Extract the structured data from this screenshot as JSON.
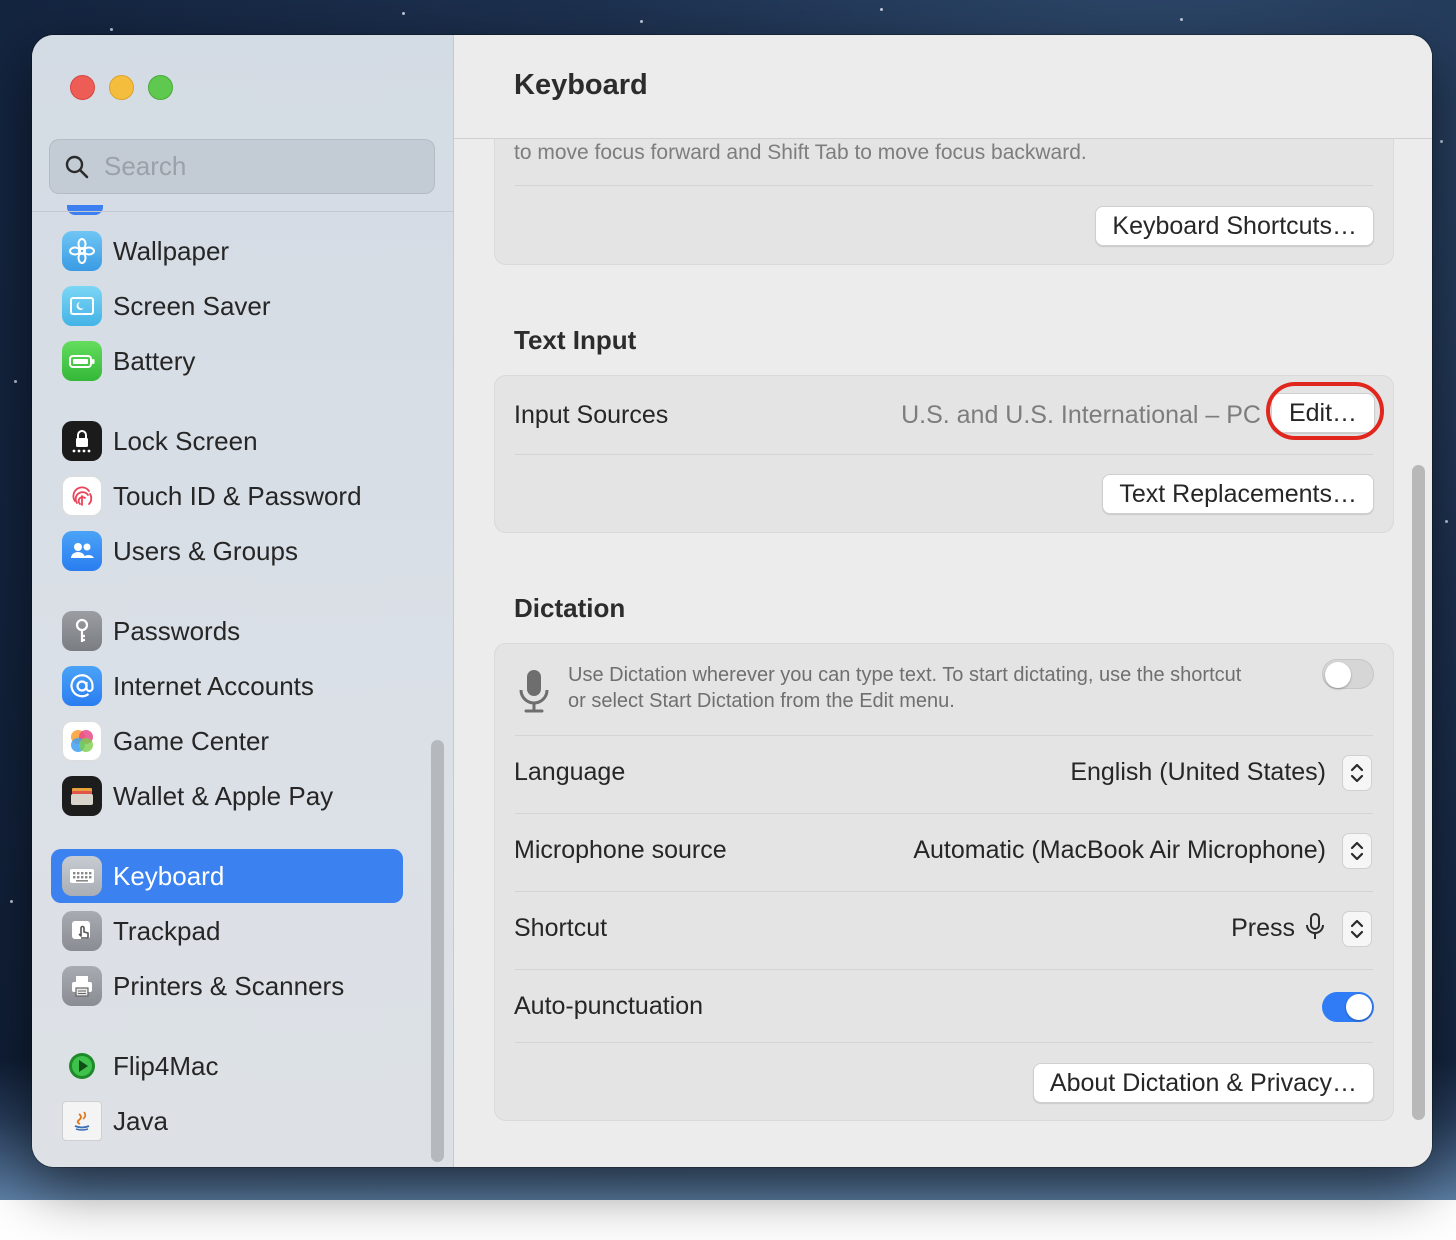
{
  "window": {
    "title": "Keyboard"
  },
  "search": {
    "placeholder": "Search"
  },
  "sidebar": {
    "items": [
      {
        "label": "Wallpaper",
        "icon": "wallpaper-icon"
      },
      {
        "label": "Screen Saver",
        "icon": "screen-saver-icon"
      },
      {
        "label": "Battery",
        "icon": "battery-icon"
      },
      {
        "label": "Lock Screen",
        "icon": "lock-icon"
      },
      {
        "label": "Touch ID & Password",
        "icon": "fingerprint-icon"
      },
      {
        "label": "Users & Groups",
        "icon": "users-icon"
      },
      {
        "label": "Passwords",
        "icon": "key-icon"
      },
      {
        "label": "Internet Accounts",
        "icon": "at-sign-icon"
      },
      {
        "label": "Game Center",
        "icon": "game-center-icon"
      },
      {
        "label": "Wallet & Apple Pay",
        "icon": "wallet-icon"
      },
      {
        "label": "Keyboard",
        "icon": "keyboard-icon",
        "selected": true
      },
      {
        "label": "Trackpad",
        "icon": "trackpad-icon"
      },
      {
        "label": "Printers & Scanners",
        "icon": "printer-icon"
      },
      {
        "label": "Flip4Mac",
        "icon": "flip4mac-icon"
      },
      {
        "label": "Java",
        "icon": "java-icon"
      }
    ]
  },
  "keyboard_nav": {
    "description_tail": "to move focus forward and Shift Tab to move focus backward.",
    "shortcuts_button": "Keyboard Shortcuts…"
  },
  "text_input": {
    "heading": "Text Input",
    "input_sources_label": "Input Sources",
    "input_sources_value": "U.S. and U.S. International – PC",
    "edit_button": "Edit…",
    "replacements_button": "Text Replacements…"
  },
  "dictation": {
    "heading": "Dictation",
    "description_line1": "Use Dictation wherever you can type text. To start dictating, use the shortcut",
    "description_line2": "or select Start Dictation from the Edit menu.",
    "enabled": false,
    "language_label": "Language",
    "language_value": "English (United States)",
    "mic_label": "Microphone source",
    "mic_value": "Automatic (MacBook Air Microphone)",
    "shortcut_label": "Shortcut",
    "shortcut_value": "Press",
    "autopunct_label": "Auto-punctuation",
    "autopunct_enabled": true,
    "about_button": "About Dictation & Privacy…"
  },
  "colors": {
    "accent": "#3b82f0",
    "highlight_ring": "#e0261d"
  }
}
